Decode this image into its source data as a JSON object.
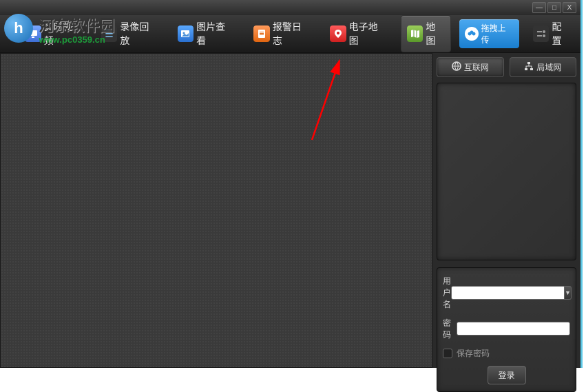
{
  "watermark": {
    "title": "河东软件园",
    "url": "www.pc0359.cn",
    "logo_letter": "h"
  },
  "toolbar": {
    "realtime": "实时视频",
    "playback": "录像回放",
    "image_view": "图片查看",
    "alarm_log": "报警日志",
    "emap": "电子地图",
    "map": "地图",
    "drag_upload": "拖拽上传",
    "config": "配置"
  },
  "window_controls": {
    "min": "—",
    "max": "□",
    "close": "X"
  },
  "right_panel": {
    "tabs": {
      "internet": "互联网",
      "lan": "局域网"
    },
    "login": {
      "username_label": "用户名",
      "password_label": "密码",
      "save_pwd_label": "保存密码",
      "login_btn": "登录",
      "username_value": "",
      "password_value": ""
    }
  }
}
